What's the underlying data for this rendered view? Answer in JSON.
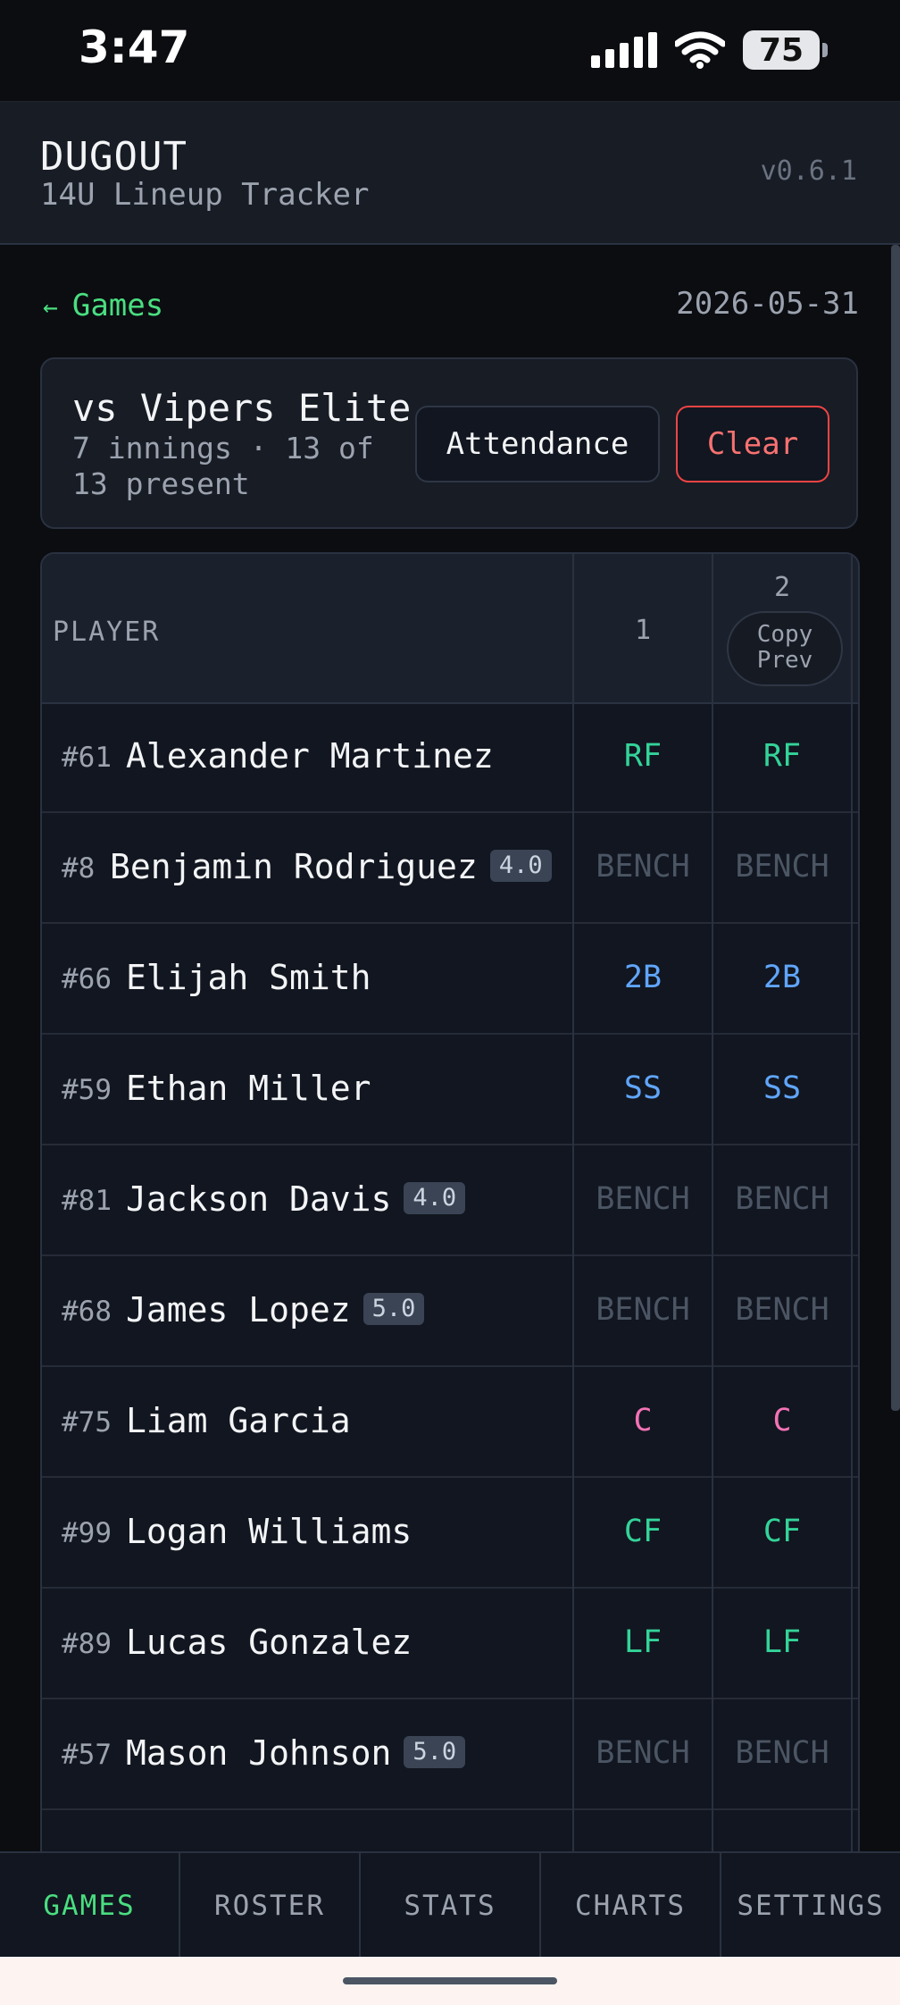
{
  "status_bar": {
    "time": "3:47",
    "battery": "75"
  },
  "header": {
    "title": "DUGOUT",
    "subtitle": "14U Lineup Tracker",
    "version": "v0.6.1"
  },
  "nav": {
    "back_label": "Games",
    "back_arrow": "←",
    "date": "2026-05-31"
  },
  "game": {
    "opponent": "vs Vipers Elite",
    "meta": "7 innings · 13 of 13 present",
    "attendance_label": "Attendance",
    "clear_label": "Clear"
  },
  "grid": {
    "player_header": "PLAYER",
    "innings": [
      "1",
      "2"
    ],
    "copy_prev_label": "Copy Prev",
    "rows": [
      {
        "num": "#61",
        "name": "Alexander Martinez",
        "tag": "",
        "pos": [
          "RF",
          "RF"
        ],
        "color": "#34d399"
      },
      {
        "num": "#8",
        "name": "Benjamin Rodriguez",
        "tag": "4.0",
        "pos": [
          "BENCH",
          "BENCH"
        ],
        "color": "#4b5563"
      },
      {
        "num": "#66",
        "name": "Elijah Smith",
        "tag": "",
        "pos": [
          "2B",
          "2B"
        ],
        "color": "#60a5fa"
      },
      {
        "num": "#59",
        "name": "Ethan Miller",
        "tag": "",
        "pos": [
          "SS",
          "SS"
        ],
        "color": "#60a5fa"
      },
      {
        "num": "#81",
        "name": "Jackson Davis",
        "tag": "4.0",
        "pos": [
          "BENCH",
          "BENCH"
        ],
        "color": "#4b5563"
      },
      {
        "num": "#68",
        "name": "James Lopez",
        "tag": "5.0",
        "pos": [
          "BENCH",
          "BENCH"
        ],
        "color": "#4b5563"
      },
      {
        "num": "#75",
        "name": "Liam Garcia",
        "tag": "",
        "pos": [
          "C",
          "C"
        ],
        "color": "#f472b6"
      },
      {
        "num": "#99",
        "name": "Logan Williams",
        "tag": "",
        "pos": [
          "CF",
          "CF"
        ],
        "color": "#34d399"
      },
      {
        "num": "#89",
        "name": "Lucas Gonzalez",
        "tag": "",
        "pos": [
          "LF",
          "LF"
        ],
        "color": "#34d399"
      },
      {
        "num": "#57",
        "name": "Mason Johnson",
        "tag": "5.0",
        "pos": [
          "BENCH",
          "BENCH"
        ],
        "color": "#4b5563"
      }
    ]
  },
  "tabs": [
    {
      "label": "GAMES",
      "active": true
    },
    {
      "label": "ROSTER",
      "active": false
    },
    {
      "label": "STATS",
      "active": false
    },
    {
      "label": "CHARTS",
      "active": false
    },
    {
      "label": "SETTINGS",
      "active": false
    }
  ]
}
